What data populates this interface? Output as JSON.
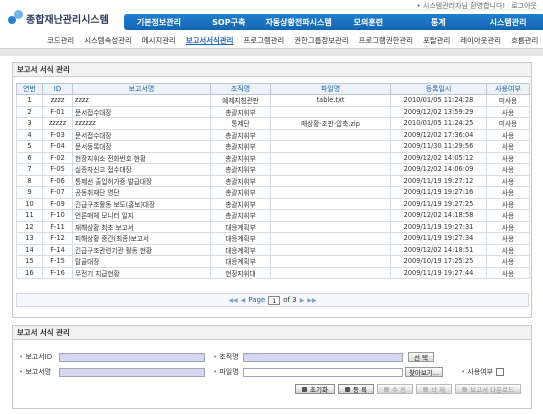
{
  "header": {
    "logo_text": "종합재난관리시스템",
    "util_links": [
      "• 시스템관리자님 환영합니다!",
      "로그아웃"
    ],
    "main_menu": [
      "기본정보관리",
      "SOP구축",
      "자동상황전파시스템",
      "모의훈련",
      "통계",
      "시스템관리"
    ],
    "sub_menu": [
      "코드관리",
      "시스템속성관리",
      "메시지관리",
      "보고서서식관리",
      "프로그램관리",
      "권한그룹정보관리",
      "프로그램권한관리",
      "포탈관리",
      "레이아웃관리",
      "흐름관리"
    ],
    "active_sub": "보고서서식관리"
  },
  "list_panel": {
    "title": "보고서 서식 관리",
    "columns": [
      "연번",
      "ID",
      "보고서명",
      "조직명",
      "파일명",
      "등록일시",
      "사용여부"
    ],
    "rows": [
      [
        "1",
        "zzzz",
        "zzzz",
        "예제지침관판",
        "table.txt",
        "2010/01/05 11:24:28",
        "미사용"
      ],
      [
        "2",
        "F-01",
        "문서접수대장",
        "총괄지휘부",
        "",
        "2009/12/02 13:59:29",
        "사용"
      ],
      [
        "3",
        "zzzzz",
        "zzzzzz",
        "통제단",
        "매상황-조판-압축.zip",
        "2010/01/05 11:24:25",
        "미사용"
      ],
      [
        "4",
        "F-03",
        "문서접수대장",
        "총괄지휘부",
        "",
        "2009/12/02 17:36:04",
        "사용"
      ],
      [
        "5",
        "F-04",
        "문서등록대장",
        "총괄지휘부",
        "",
        "2009/11/30 11:29:56",
        "사용"
      ],
      [
        "6",
        "F-02",
        "현장지휘소 전화번호 현황",
        "총괄지휘부",
        "",
        "2009/12/02 14:05:12",
        "사용"
      ],
      [
        "7",
        "F-05",
        "실종자신고 접수대장",
        "총괄지휘부",
        "",
        "2009/12/02 14:06:09",
        "사용"
      ],
      [
        "8",
        "F-06",
        "통제선 출입허가증 발급대장",
        "총괄지휘부",
        "",
        "2009/11/19 19:27:12",
        "사용"
      ],
      [
        "9",
        "F-07",
        "공동취재단 명단",
        "총괄지휘부",
        "",
        "2009/11/19 19:27:16",
        "사용"
      ],
      [
        "10",
        "F-09",
        "긴급구조활동 보도(홍보)대장",
        "총괄지휘부",
        "",
        "2009/11/19 19:27:25",
        "사용"
      ],
      [
        "11",
        "F-10",
        "언론매체 모니터 일지",
        "총괄지휘부",
        "",
        "2009/12/02 14:18:58",
        "사용"
      ],
      [
        "12",
        "F-11",
        "재해상황 최초 보고서",
        "대응계획부",
        "",
        "2009/11/19 19:27:31",
        "사용"
      ],
      [
        "13",
        "F-12",
        "피해상황 중간(최종)보고서",
        "대응계획부",
        "",
        "2009/11/19 19:27:34",
        "사용"
      ],
      [
        "14",
        "F-14",
        "긴급구조관련기관 활동 현황",
        "대응계획부",
        "",
        "2009/12/02 14:18:51",
        "사용"
      ],
      [
        "15",
        "F-15",
        "탈골대장",
        "대응계획부",
        "",
        "2009/10/19 17:25:25",
        "사용"
      ],
      [
        "16",
        "F-16",
        "무전기 지급현황",
        "현장지휘대",
        "",
        "2009/11/19 19:27:44",
        "사용"
      ]
    ],
    "pager": {
      "first": "◀◀",
      "prev": "◀",
      "page_label": "Page",
      "current": "1",
      "of_label": "of 3",
      "next": "▶",
      "last": "▶▶"
    }
  },
  "form_panel": {
    "title": "보고서 서식 관리",
    "labels": {
      "report_id": "보고서ID",
      "org_name": "조직명",
      "report_name": "보고서명",
      "file_name": "파일명",
      "use_flag": "사용여부"
    },
    "values": {
      "report_id": "",
      "org_name": "",
      "report_name": "",
      "file_name": ""
    },
    "select_button": "선 택",
    "browse_button": "찾아보기...",
    "actions": {
      "reset": "초기화",
      "register": "등 록",
      "edit": "수 정",
      "delete": "삭 제",
      "download": "보고서 다운로드"
    }
  },
  "colors": {
    "gnb": "#1f7fcf",
    "active_sub": "#1d64b2",
    "input_fill": "#d3d7ef"
  }
}
